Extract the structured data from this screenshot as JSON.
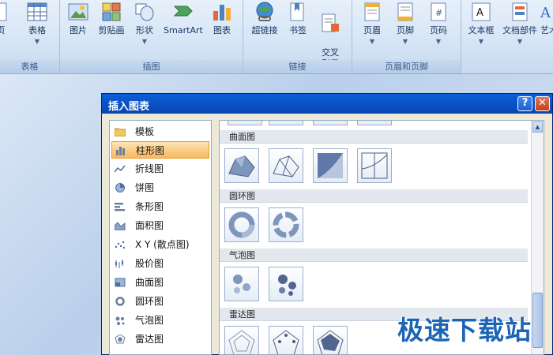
{
  "ribbon": {
    "groups": [
      {
        "title": "表格",
        "buttons": [
          {
            "label": "页"
          },
          {
            "label": "表格"
          }
        ]
      },
      {
        "title": "插图",
        "buttons": [
          {
            "label": "图片"
          },
          {
            "label": "剪贴画"
          },
          {
            "label": "形状"
          },
          {
            "label": "SmartArt"
          },
          {
            "label": "图表"
          }
        ]
      },
      {
        "title": "链接",
        "buttons": [
          {
            "label": "超链接"
          },
          {
            "label": "书签"
          },
          {
            "label": "交叉\n引用"
          }
        ]
      },
      {
        "title": "页眉和页脚",
        "buttons": [
          {
            "label": "页眉"
          },
          {
            "label": "页脚"
          },
          {
            "label": "页码"
          }
        ]
      },
      {
        "title": "",
        "buttons": [
          {
            "label": "文本框"
          },
          {
            "label": "文档部件"
          },
          {
            "label": "艺术"
          }
        ]
      }
    ]
  },
  "dialog": {
    "title": "插入图表",
    "help_label": "?",
    "close_label": "✕",
    "categories": [
      {
        "label": "模板"
      },
      {
        "label": "柱形图"
      },
      {
        "label": "折线图"
      },
      {
        "label": "饼图"
      },
      {
        "label": "条形图"
      },
      {
        "label": "面积图"
      },
      {
        "label": "X Y (散点图)"
      },
      {
        "label": "股价图"
      },
      {
        "label": "曲面图"
      },
      {
        "label": "圆环图"
      },
      {
        "label": "气泡图"
      },
      {
        "label": "雷达图"
      }
    ],
    "selected_category": "柱形图",
    "sections": [
      {
        "title": "曲面图"
      },
      {
        "title": "圆环图"
      },
      {
        "title": "气泡图"
      },
      {
        "title": "雷达图"
      }
    ]
  },
  "watermark": "极速下载站",
  "colors": {
    "accent_blue": "#0a4fc0",
    "selection": "#f9b85f",
    "ribbon": "#d5e4f5"
  }
}
